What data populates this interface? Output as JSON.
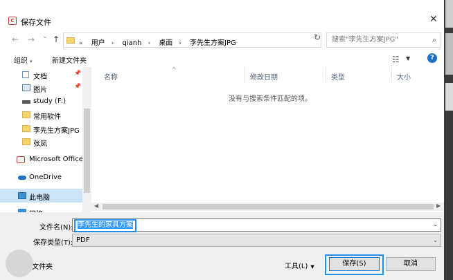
{
  "window": {
    "title": "保存文件"
  },
  "nav": {
    "back_glyph": "←",
    "forward_glyph": "→",
    "dropdown_glyph": "⌄",
    "up_glyph": "↑"
  },
  "address": {
    "crumbs": [
      "«",
      "用户",
      "qianh",
      "桌面",
      "李先生方案JPG"
    ],
    "dropdown_glyph": "⌄",
    "refresh_glyph": "↻"
  },
  "search": {
    "placeholder": "搜索\"李先生方案JPG\"",
    "icon": "search-icon"
  },
  "toolbar": {
    "organize": "组织",
    "new_folder": "新建文件夹",
    "help": "?"
  },
  "sidebar": {
    "items": [
      {
        "label": "文档",
        "icon": "document-icon",
        "pinned": true
      },
      {
        "label": "图片",
        "icon": "picture-icon",
        "pinned": true
      },
      {
        "label": "study (F:)",
        "icon": "drive-icon",
        "pinned": false
      },
      {
        "label": "常用软件",
        "icon": "folder-icon",
        "pinned": false
      },
      {
        "label": "李先生方案JPG",
        "icon": "folder-icon",
        "pinned": false
      },
      {
        "label": "张凤",
        "icon": "folder-icon",
        "pinned": false
      },
      {
        "label": "Microsoft Office",
        "icon": "office-icon",
        "pinned": false
      },
      {
        "label": "OneDrive",
        "icon": "cloud-icon",
        "pinned": false
      },
      {
        "label": "此电脑",
        "icon": "computer-icon",
        "pinned": false,
        "selected": true
      },
      {
        "label": "网络",
        "icon": "network-icon",
        "pinned": false
      }
    ]
  },
  "filelist": {
    "columns": [
      "名称",
      "修改日期",
      "类型",
      "大小"
    ],
    "empty_message": "没有与搜索条件匹配的项。"
  },
  "form": {
    "filename_label": "文件名(N):",
    "filename_value": "李先生的家具方案",
    "filetype_label": "保存类型(T):",
    "filetype_value": "PDF"
  },
  "footer": {
    "hide_folders": "隐藏文件夹",
    "tools": "工具(L)",
    "save": "保存(S)",
    "cancel": "取消"
  },
  "colors": {
    "accent": "#1e8ee8",
    "selection": "#cce4f7",
    "help": "#1e6fc4"
  }
}
